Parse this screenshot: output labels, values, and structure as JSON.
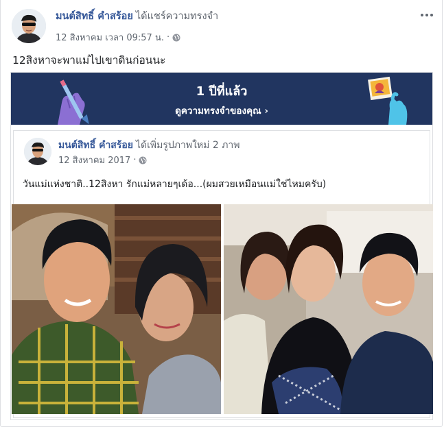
{
  "post": {
    "author": "มนต์สิทธิ์ คำสร้อย",
    "action": "ได้แชร์ความทรงจำ",
    "timestamp": "12 สิงหาคม เวลา 09:57 น.",
    "separator": "·",
    "text": "12สิงหาจะพาแม่ไปเขาดินก่อนนะ"
  },
  "memory": {
    "title": "1 ปีที่แล้ว",
    "link_label": "ดูความทรงจำของคุณ",
    "link_chevron": "›"
  },
  "shared_post": {
    "author": "มนต์สิทธิ์ คำสร้อย",
    "action": "ได้เพิ่มรูปภาพใหม่ 2 ภาพ",
    "timestamp": "12 สิงหาคม 2017",
    "separator": "·",
    "text": "วันแม่แห่งชาติ..12สิงหา รักแม่หลายๆเด้อ...(ผมสวยเหมือนแม่ใช่ไหมครับ)"
  },
  "icons": {
    "options": "more-options-icon",
    "privacy": "globe-icon",
    "banner_left": "pencil-hand-icon",
    "banner_right": "photo-hand-icon"
  },
  "colors": {
    "banner_bg": "#213560",
    "name_link": "#365899",
    "meta_text": "#606770"
  }
}
